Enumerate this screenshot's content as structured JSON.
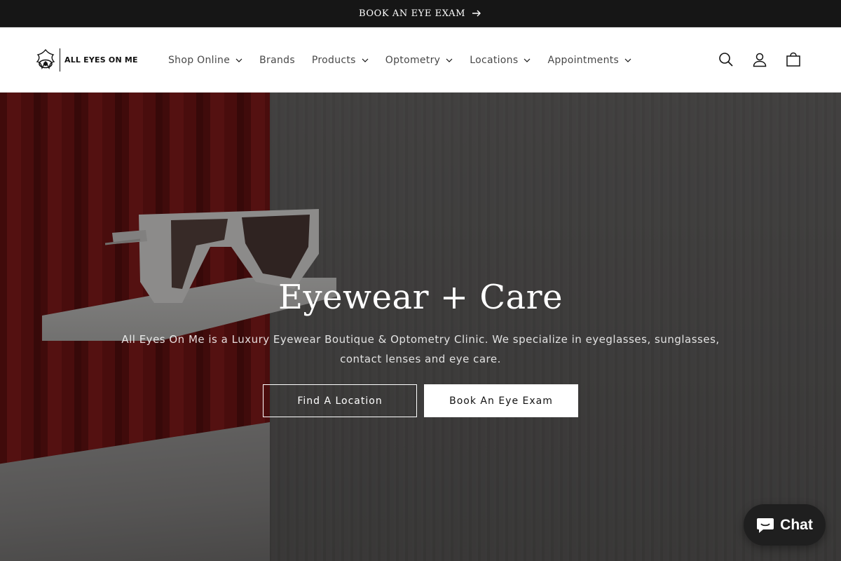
{
  "announcement": {
    "text": "BOOK AN EYE EXAM",
    "arrow_icon": "arrow-right-icon"
  },
  "header": {
    "logo_text": "ALL EYES ON ME",
    "nav": [
      {
        "label": "Shop Online",
        "has_dropdown": true
      },
      {
        "label": "Brands",
        "has_dropdown": false
      },
      {
        "label": "Products",
        "has_dropdown": true
      },
      {
        "label": "Optometry",
        "has_dropdown": true
      },
      {
        "label": "Locations",
        "has_dropdown": true
      },
      {
        "label": "Appointments",
        "has_dropdown": true
      }
    ],
    "icons": [
      "search-icon",
      "account-icon",
      "cart-icon"
    ]
  },
  "hero": {
    "title": "Eyewear + Care",
    "text": "All Eyes On Me is a Luxury Eyewear Boutique & Optometry Clinic. We specialize in eyeglasses, sunglasses, contact lenses and eye care.",
    "buttons": {
      "primary": "Find A Location",
      "secondary": "Book An Eye Exam"
    }
  },
  "chat": {
    "label": "Chat",
    "icon": "chat-bubble-icon"
  },
  "colors": {
    "announcement_bg": "#161616",
    "header_bg": "#ffffff",
    "text": "#121212",
    "chat_bg": "#1f1f1f",
    "curtain": "#8d1d1d"
  }
}
